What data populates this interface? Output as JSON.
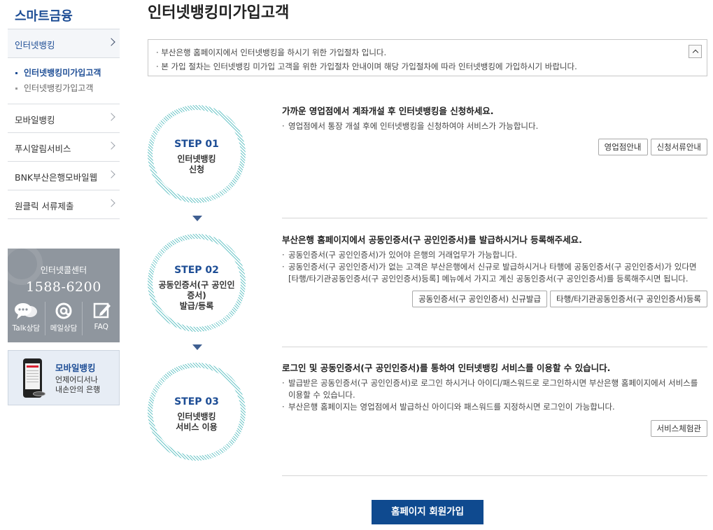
{
  "sidebar": {
    "title": "스마트금융",
    "items": [
      {
        "label": "인터넷뱅킹",
        "active": true
      },
      {
        "label": "모바일뱅킹"
      },
      {
        "label": "푸시알림서비스"
      },
      {
        "label": "BNK부산은행모바일웹"
      },
      {
        "label": "원클릭 서류제출"
      }
    ],
    "subitems": [
      {
        "label": "인터넷뱅킹미가입고객",
        "current": true
      },
      {
        "label": "인터넷뱅킹가입고객"
      }
    ]
  },
  "callcenter": {
    "title": "인터넷콜센터",
    "phone": "1588-6200",
    "icons": [
      {
        "label": "Talk상담",
        "icon": "chat-icon"
      },
      {
        "label": "메일상담",
        "icon": "mail-icon"
      },
      {
        "label": "FAQ",
        "icon": "edit-icon"
      }
    ]
  },
  "mobile_banner": {
    "title": "모바일뱅킹",
    "desc_line1": "언제어디서나",
    "desc_line2": "내손안의 은행"
  },
  "page": {
    "title": "인터넷뱅킹미가입고객"
  },
  "notice": {
    "line1": "부산은행 홈페이지에서 인터넷뱅킹을 하시기 위한 가입절차 입니다.",
    "line2": "본 가입 절차는 인터넷뱅킹 미가입 고객을 위한 가입절차 안내이며 해당 가입절차에 따라 인터넷뱅킹에 가입하시기 바랍니다."
  },
  "steps": [
    {
      "num": "STEP 01",
      "name_line1": "인터넷뱅킹",
      "name_line2": "신청",
      "heading": "가까운 영업점에서 계좌개설 후 인터넷뱅킹을 신청하세요.",
      "bullets": [
        "영업점에서 통장 개설 후에 인터넷뱅킹을 신청하여야 서비스가 가능합니다."
      ],
      "buttons": [
        "영업점안내",
        "신청서류안내"
      ]
    },
    {
      "num": "STEP 02",
      "name_line1": "공동인증서(구 공인인",
      "name_line2": "증서)",
      "name_line3": "발급/등록",
      "heading": "부산은행 홈페이지에서 공동인증서(구 공인인증서)를 발급하시거나 등록해주세요.",
      "bullets": [
        "공동인증서(구 공인인증서)가 있어야 은행의 거래업무가 가능합니다.",
        "공동인증서(구 공인인증서)가 없는 고객은 부산은행에서 신규로 발급하시거나 타행에 공동인증서(구 공인인증서)가 있다면 [타행/타기관공동인증서(구 공인인증서)등록] 메뉴에서 가지고 계신 공동인증서(구 공인인증서)를 등록해주시면 됩니다."
      ],
      "buttons": [
        "공동인증서(구 공인인증서) 신규발급",
        "타행/타기관공동인증서(구 공인인증서)등록"
      ]
    },
    {
      "num": "STEP 03",
      "name_line1": "인터넷뱅킹",
      "name_line2": "서비스 이용",
      "heading": "로그인 및 공동인증서(구 공인인증서)를 통하여 인터넷뱅킹 서비스를 이용할 수 있습니다.",
      "bullets": [
        "발급받은 공동인증서(구 공인인증서)로 로그인 하시거나 아이디/패스워드로 로그인하시면 부산은행 홈페이지에서 서비스를 이용할 수 있습니다.",
        "부산은행 홈페이지는 영업점에서 발급하신 아이디와 패스워드를 지정하시면 로그인이 가능합니다."
      ],
      "buttons": [
        "서비스체험관"
      ]
    }
  ],
  "join_button": "홈페이지 회원가입",
  "colors": {
    "brand_blue": "#1d4d95",
    "button_navy": "#0f4a8f",
    "circle_stripe": "#6fc7c9",
    "callcenter_gray": "#8f969e"
  }
}
